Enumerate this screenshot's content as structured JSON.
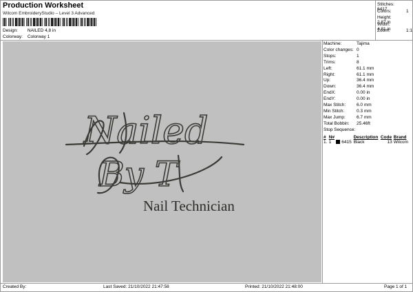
{
  "header": {
    "title": "Production Worksheet",
    "subtitle": "Wilcom EmbroideryStudio – Level 3 Advanced",
    "design_label": "Design:",
    "design_value": "NAILED 4,8 in",
    "colorway_label": "Colorway:",
    "colorway_value": "Colorway 1"
  },
  "stats": [
    {
      "label": "Stitches:",
      "value": "6417"
    },
    {
      "label": "Colors:",
      "value": "1"
    },
    {
      "label": "Height:",
      "value": "2.87 in"
    },
    {
      "label": "Width:",
      "value": "4.81 in"
    },
    {
      "label": "Zoom:",
      "value": "1:1"
    }
  ],
  "design_text": {
    "line1": "Nailed",
    "line2": "By T",
    "line3": "Nail Technician"
  },
  "machine_info": [
    {
      "label": "Machine:",
      "value": "Tajima"
    },
    {
      "label": "Color changes:",
      "value": "0"
    },
    {
      "label": "Stops:",
      "value": "1"
    },
    {
      "label": "Trims:",
      "value": "8"
    },
    {
      "label": "Left:",
      "value": "61.1 mm"
    },
    {
      "label": "Right:",
      "value": "61.1 mm"
    },
    {
      "label": "Up:",
      "value": "36.4 mm"
    },
    {
      "label": "Down:",
      "value": "36.4 mm"
    },
    {
      "label": "EndX:",
      "value": "0.00 in"
    },
    {
      "label": "EndY:",
      "value": "0.00 in"
    },
    {
      "label": "Max Stitch:",
      "value": "6.0 mm"
    },
    {
      "label": "Min Stitch:",
      "value": "0.3 mm"
    },
    {
      "label": "Max Jump:",
      "value": "6.7 mm"
    },
    {
      "label": "Total Bobbin:",
      "value": "25.46ft"
    }
  ],
  "stop_sequence": {
    "heading": "Stop Sequence:",
    "columns": [
      "#",
      "N#",
      "",
      "Description",
      "Code",
      "Brand"
    ],
    "rows": [
      {
        "num": "1.",
        "n": "1",
        "stitches": "6415",
        "description": "Black",
        "code": "13",
        "brand": "Wilcom",
        "color": "#000000"
      }
    ]
  },
  "footer": {
    "created": "Created By:",
    "last_saved": "Last Saved: 21/10/2022 21:47:58",
    "printed": "Printed: 21/10/2022 21:48:00",
    "page": "Page 1 of 1"
  },
  "colors": {
    "design_bg": "#c0c0c0",
    "thread": "#3a3a36"
  }
}
